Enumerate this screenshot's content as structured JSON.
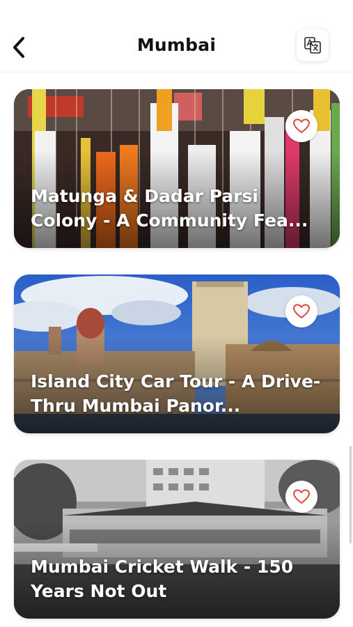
{
  "header": {
    "title": "Mumbai",
    "back_icon": "chevron-left-icon",
    "translate_icon": "translate-icon"
  },
  "tours": [
    {
      "title": "Matunga & Dadar Parsi Colony - A Community Fea...",
      "favorite_icon": "heart-outline-icon"
    },
    {
      "title": "Island City Car Tour -  A Drive-Thru Mumbai Panor...",
      "favorite_icon": "heart-outline-icon"
    },
    {
      "title": "Mumbai Cricket Walk - 150 Years Not Out",
      "favorite_icon": "heart-outline-icon"
    }
  ],
  "colors": {
    "accent": "#e0443a",
    "text": "#111111"
  }
}
